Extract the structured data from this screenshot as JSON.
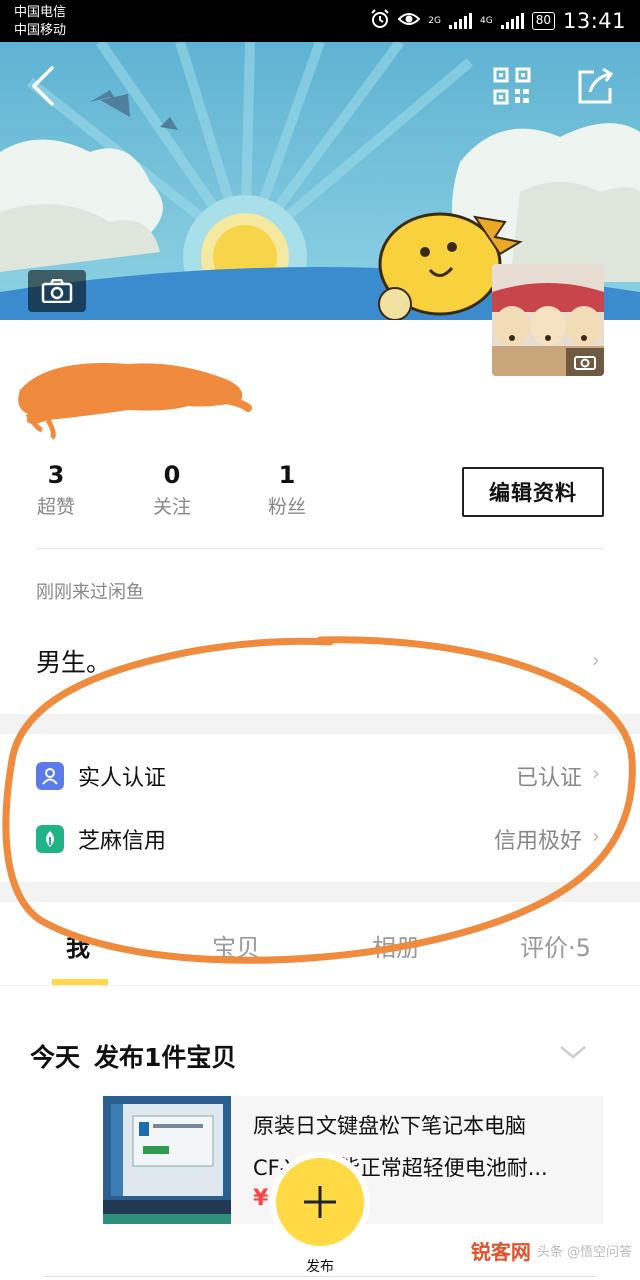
{
  "status_bar": {
    "carrier_1": "中国电信",
    "carrier_2": "中国移动",
    "network_1": "2G",
    "network_2": "4G",
    "battery": "80",
    "time": "13:41"
  },
  "header": {
    "back_icon": "chevron-left-icon",
    "qr_icon": "qr-code-icon",
    "share_icon": "share-icon",
    "cover_camera_icon": "camera-icon"
  },
  "stats": [
    {
      "value": "3",
      "label": "超赞"
    },
    {
      "value": "0",
      "label": "关注"
    },
    {
      "value": "1",
      "label": "粉丝"
    }
  ],
  "edit_profile_label": "编辑资料",
  "last_visit": "刚刚来过闲鱼",
  "bio": "男生。",
  "verification_rows": [
    {
      "icon": "user-shield-icon",
      "label": "实人认证",
      "value": "已认证",
      "icon_color": "#5b7bea"
    },
    {
      "icon": "leaf-icon",
      "label": "芝麻信用",
      "value": "信用极好",
      "icon_color": "#1fb487"
    }
  ],
  "tabs": [
    {
      "label": "我",
      "active": true
    },
    {
      "label": "宝贝",
      "active": false
    },
    {
      "label": "相册",
      "active": false
    },
    {
      "label": "评价·5",
      "active": false
    }
  ],
  "feed": {
    "day": "今天",
    "summary": "发布1件宝贝",
    "item": {
      "title_line1": "原装日文键盘松下笔记本电脑",
      "title_line2": "CF-Y2 功能正常超轻便电池耐...",
      "price": "¥  0"
    }
  },
  "publish_label": "发布",
  "watermark": {
    "text": "锐客网",
    "source": "头条 @悟空问答"
  },
  "colors": {
    "accent_yellow": "#ffda44",
    "annotation_orange": "#f08a3c",
    "banner_sky": "#6fbfd8"
  }
}
